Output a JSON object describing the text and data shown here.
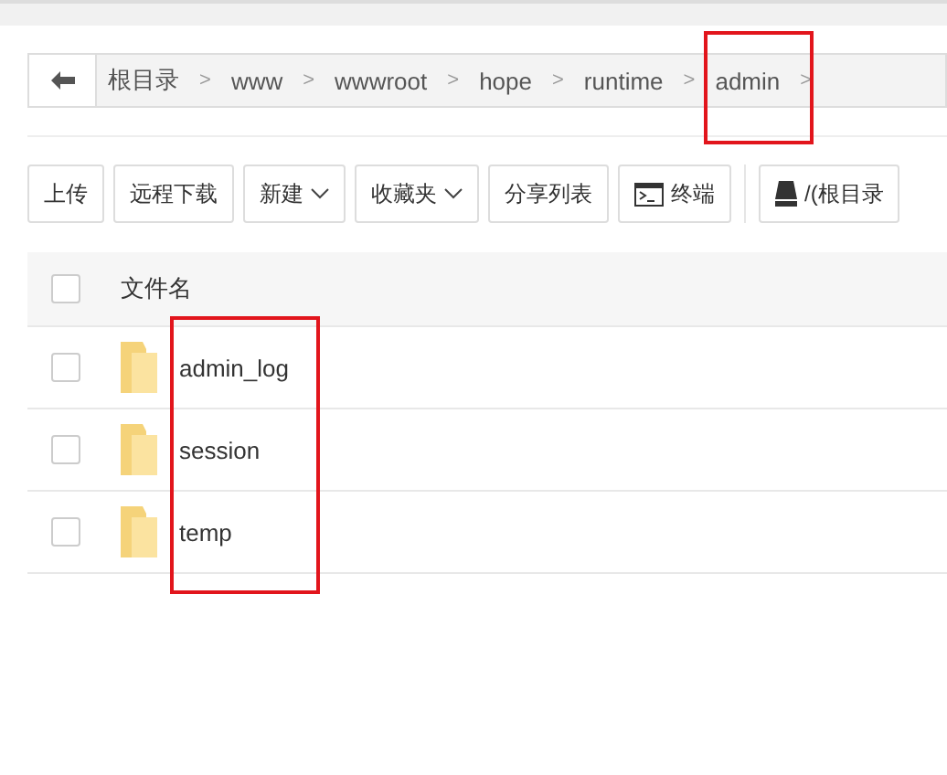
{
  "breadcrumb": {
    "root": "根目录",
    "items": [
      "www",
      "wwwroot",
      "hope",
      "runtime",
      "admin"
    ],
    "separator": ">"
  },
  "toolbar": [
    {
      "label": "上传",
      "kind": "plain"
    },
    {
      "label": "远程下载",
      "kind": "plain"
    },
    {
      "label": "新建",
      "kind": "dropdown"
    },
    {
      "label": "收藏夹",
      "kind": "dropdown"
    },
    {
      "label": "分享列表",
      "kind": "plain"
    },
    {
      "label": "终端",
      "kind": "terminal"
    },
    {
      "label": "/(根目录",
      "kind": "disk"
    }
  ],
  "table": {
    "columns": [
      "文件名"
    ],
    "header_checked": false,
    "rows": [
      {
        "name": "admin_log",
        "checked": false
      },
      {
        "name": "session",
        "checked": false
      },
      {
        "name": "temp",
        "checked": false
      }
    ]
  }
}
